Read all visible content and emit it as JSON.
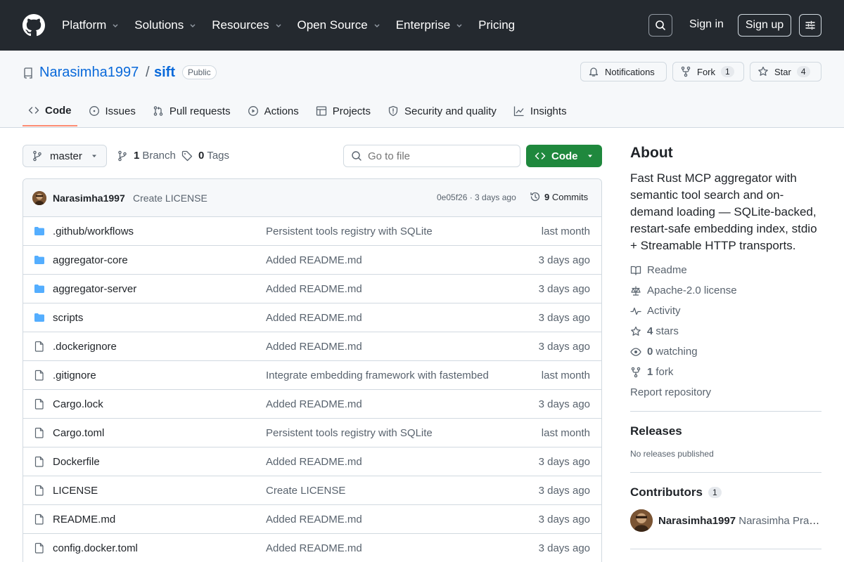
{
  "topnav": {
    "items": [
      {
        "label": "Platform",
        "dropdown": true
      },
      {
        "label": "Solutions",
        "dropdown": true
      },
      {
        "label": "Resources",
        "dropdown": true
      },
      {
        "label": "Open Source",
        "dropdown": true
      },
      {
        "label": "Enterprise",
        "dropdown": true
      },
      {
        "label": "Pricing",
        "dropdown": false
      }
    ],
    "sign_in": "Sign in",
    "sign_up": "Sign up"
  },
  "repo": {
    "owner": "Narasimha1997",
    "separator": "/",
    "name": "sift",
    "visibility": "Public",
    "notifications_label": "Notifications",
    "fork_label": "Fork",
    "fork_count": "1",
    "star_label": "Star",
    "star_count": "4"
  },
  "tabs": [
    {
      "label": "Code",
      "icon": "code-icon",
      "active": true
    },
    {
      "label": "Issues",
      "icon": "issue-icon"
    },
    {
      "label": "Pull requests",
      "icon": "pull-request-icon"
    },
    {
      "label": "Actions",
      "icon": "play-icon"
    },
    {
      "label": "Projects",
      "icon": "table-icon"
    },
    {
      "label": "Security and quality",
      "icon": "shield-icon"
    },
    {
      "label": "Insights",
      "icon": "graph-icon"
    }
  ],
  "controls": {
    "branch": "master",
    "branch_count": "1",
    "branch_label": "Branch",
    "tag_count": "0",
    "tag_label": "Tags",
    "goto_placeholder": "Go to file",
    "code_button": "Code"
  },
  "latest_commit": {
    "author": "Narasimha1997",
    "message": "Create LICENSE",
    "hash_age": "0e05f26 · 3 days ago",
    "commits_count": "9",
    "commits_label": "Commits"
  },
  "files": [
    {
      "name": ".github/workflows",
      "type": "folder",
      "message": "Persistent tools registry with SQLite",
      "age": "last month"
    },
    {
      "name": "aggregator-core",
      "type": "folder",
      "message": "Added README.md",
      "age": "3 days ago"
    },
    {
      "name": "aggregator-server",
      "type": "folder",
      "message": "Added README.md",
      "age": "3 days ago"
    },
    {
      "name": "scripts",
      "type": "folder",
      "message": "Added README.md",
      "age": "3 days ago"
    },
    {
      "name": ".dockerignore",
      "type": "file",
      "message": "Added README.md",
      "age": "3 days ago"
    },
    {
      "name": ".gitignore",
      "type": "file",
      "message": "Integrate embedding framework with fastembed",
      "age": "last month"
    },
    {
      "name": "Cargo.lock",
      "type": "file",
      "message": "Added README.md",
      "age": "3 days ago"
    },
    {
      "name": "Cargo.toml",
      "type": "file",
      "message": "Persistent tools registry with SQLite",
      "age": "last month"
    },
    {
      "name": "Dockerfile",
      "type": "file",
      "message": "Added README.md",
      "age": "3 days ago"
    },
    {
      "name": "LICENSE",
      "type": "file",
      "message": "Create LICENSE",
      "age": "3 days ago"
    },
    {
      "name": "README.md",
      "type": "file",
      "message": "Added README.md",
      "age": "3 days ago"
    },
    {
      "name": "config.docker.toml",
      "type": "file",
      "message": "Added README.md",
      "age": "3 days ago"
    }
  ],
  "about": {
    "title": "About",
    "description": "Fast Rust MCP aggregator with semantic tool search and on-demand loading — SQLite-backed, restart-safe embedding index, stdio + Streamable HTTP transports.",
    "readme": "Readme",
    "license": "Apache-2.0 license",
    "activity": "Activity",
    "stars_count": "4",
    "stars_label": "stars",
    "watching_count": "0",
    "watching_label": "watching",
    "fork_count": "1",
    "fork_label": "fork",
    "report": "Report repository"
  },
  "releases": {
    "title": "Releases",
    "empty": "No releases published"
  },
  "contributors": {
    "title": "Contributors",
    "count": "1",
    "login": "Narasimha1997",
    "full_name": "Narasimha Pras..."
  },
  "colors": {
    "header_bg": "#24292f",
    "link": "#0969da",
    "primary_button": "#1f883d",
    "folder": "#54aeff",
    "active_tab_underline": "#fd8c73"
  }
}
